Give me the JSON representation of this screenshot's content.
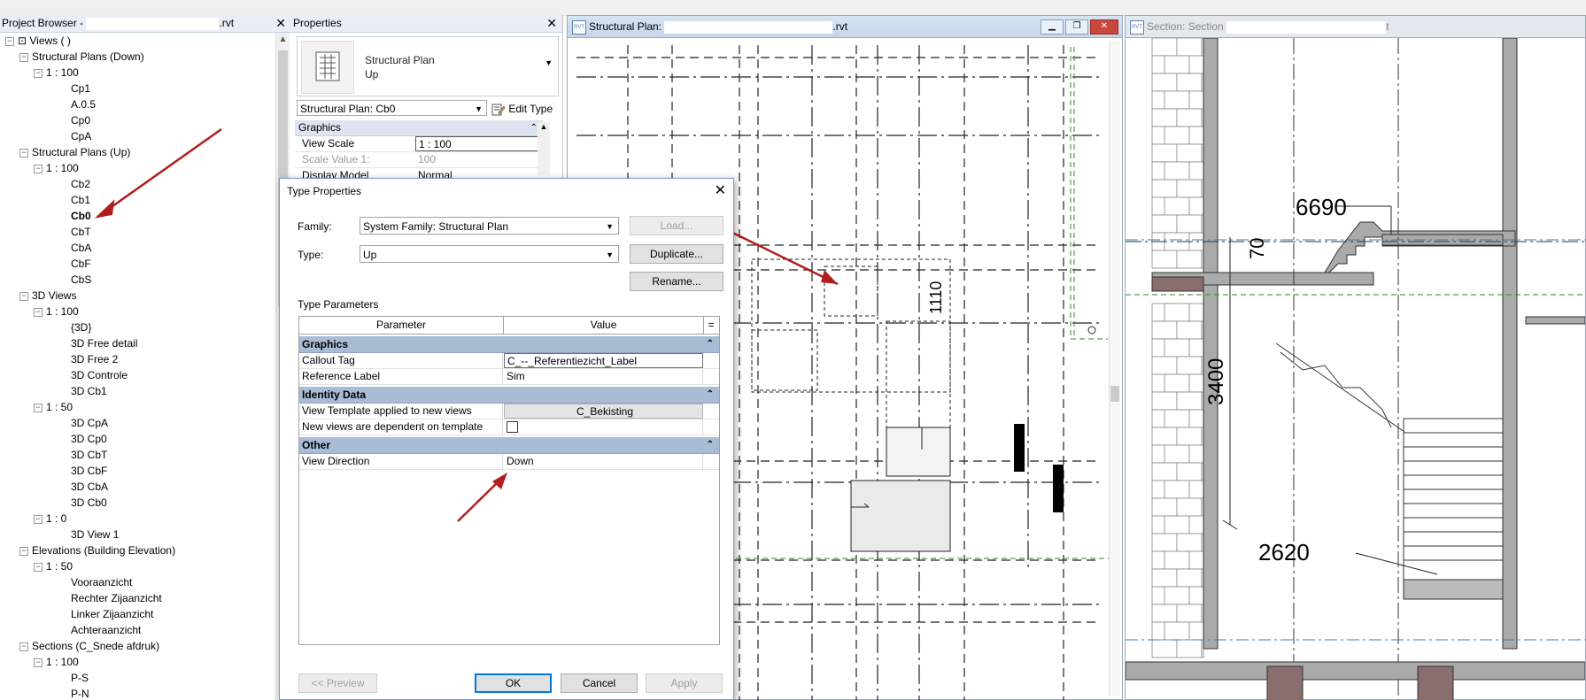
{
  "project_browser": {
    "title": "Project Browser - ",
    "title_suffix": ".rvt",
    "tree": [
      {
        "label": "Views (      )",
        "level": 0,
        "toggle": "−"
      },
      {
        "label": "Structural Plans (Down)",
        "level": 1,
        "toggle": "−"
      },
      {
        "label": "1 : 100",
        "level": 2,
        "toggle": "−"
      },
      {
        "label": "Cp1",
        "level": 3
      },
      {
        "label": "A.0.5",
        "level": 3
      },
      {
        "label": "Cp0",
        "level": 3
      },
      {
        "label": "CpA",
        "level": 3
      },
      {
        "label": "Structural Plans (Up)",
        "level": 1,
        "toggle": "−"
      },
      {
        "label": "1 : 100",
        "level": 2,
        "toggle": "−"
      },
      {
        "label": "Cb2",
        "level": 3
      },
      {
        "label": "Cb1",
        "level": 3
      },
      {
        "label": "Cb0",
        "level": 3,
        "selected": true
      },
      {
        "label": "CbT",
        "level": 3
      },
      {
        "label": "CbA",
        "level": 3
      },
      {
        "label": "CbF",
        "level": 3
      },
      {
        "label": "CbS",
        "level": 3
      },
      {
        "label": "3D Views",
        "level": 1,
        "toggle": "−"
      },
      {
        "label": "1 : 100",
        "level": 2,
        "toggle": "−"
      },
      {
        "label": "{3D}",
        "level": 3
      },
      {
        "label": "3D Free detail",
        "level": 3
      },
      {
        "label": "3D Free 2",
        "level": 3
      },
      {
        "label": "3D Controle",
        "level": 3
      },
      {
        "label": "3D Cb1",
        "level": 3
      },
      {
        "label": "1 : 50",
        "level": 2,
        "toggle": "−"
      },
      {
        "label": "3D CpA",
        "level": 3
      },
      {
        "label": "3D Cp0",
        "level": 3
      },
      {
        "label": "3D CbT",
        "level": 3
      },
      {
        "label": "3D CbF",
        "level": 3
      },
      {
        "label": "3D CbA",
        "level": 3
      },
      {
        "label": "3D Cb0",
        "level": 3
      },
      {
        "label": "1 : 0",
        "level": 2,
        "toggle": "−"
      },
      {
        "label": "3D View 1",
        "level": 3
      },
      {
        "label": "Elevations (Building Elevation)",
        "level": 1,
        "toggle": "−"
      },
      {
        "label": "1 : 50",
        "level": 2,
        "toggle": "−"
      },
      {
        "label": "Vooraanzicht",
        "level": 3
      },
      {
        "label": "Rechter Zijaanzicht",
        "level": 3
      },
      {
        "label": "Linker Zijaanzicht",
        "level": 3
      },
      {
        "label": "Achteraanzicht",
        "level": 3
      },
      {
        "label": "Sections (C_Snede afdruk)",
        "level": 1,
        "toggle": "−"
      },
      {
        "label": "1 : 100",
        "level": 2,
        "toggle": "−"
      },
      {
        "label": "P-S",
        "level": 3
      },
      {
        "label": "P-N",
        "level": 3
      }
    ]
  },
  "properties": {
    "title": "Properties",
    "type_family": "Structural Plan",
    "type_name": "Up",
    "instance_selector": "Structural Plan: Cb0",
    "edit_type": "Edit Type",
    "group": "Graphics",
    "rows": [
      {
        "key": "View Scale",
        "value": "1 : 100",
        "boxed": true
      },
      {
        "key": "Scale Value    1:",
        "value": "100",
        "muted": true
      },
      {
        "key": "Display Model",
        "value": "Normal"
      }
    ]
  },
  "view_plan": {
    "title": "Structural Plan: ",
    "title_suffix": ".rvt",
    "dimension": "1110"
  },
  "view_section": {
    "title": "Section: Section ",
    "title_suffix": "t",
    "dimensions": [
      "6690",
      "70",
      "3400",
      "2620"
    ]
  },
  "dialog": {
    "title": "Type Properties",
    "family_label": "Family:",
    "family_value": "System Family: Structural Plan",
    "type_label": "Type:",
    "type_value": "Up",
    "load_button": "Load...",
    "duplicate_button": "Duplicate...",
    "rename_button": "Rename...",
    "type_parameters_label": "Type Parameters",
    "col_parameter": "Parameter",
    "col_value": "Value",
    "col_extra": "=",
    "groups": [
      {
        "name": "Graphics",
        "rows": [
          {
            "key": "Callout Tag",
            "value": "C_--_Referentiezicht_Label",
            "kind": "edit"
          },
          {
            "key": "Reference Label",
            "value": "Sim",
            "kind": "text"
          }
        ]
      },
      {
        "name": "Identity Data",
        "rows": [
          {
            "key": "View Template applied to new views",
            "value": "C_Bekisting",
            "kind": "button"
          },
          {
            "key": "New views are dependent on template",
            "value": "",
            "kind": "checkbox"
          }
        ]
      },
      {
        "name": "Other",
        "rows": [
          {
            "key": "View Direction",
            "value": "Down",
            "kind": "text"
          }
        ]
      }
    ],
    "preview_button": "<< Preview",
    "ok_button": "OK",
    "cancel_button": "Cancel",
    "apply_button": "Apply"
  },
  "colors": {
    "annotation_arrow": "#b01e1e",
    "dialog_group_header": "#a8bcd6",
    "title_bar_active": "#c6d6ea"
  }
}
